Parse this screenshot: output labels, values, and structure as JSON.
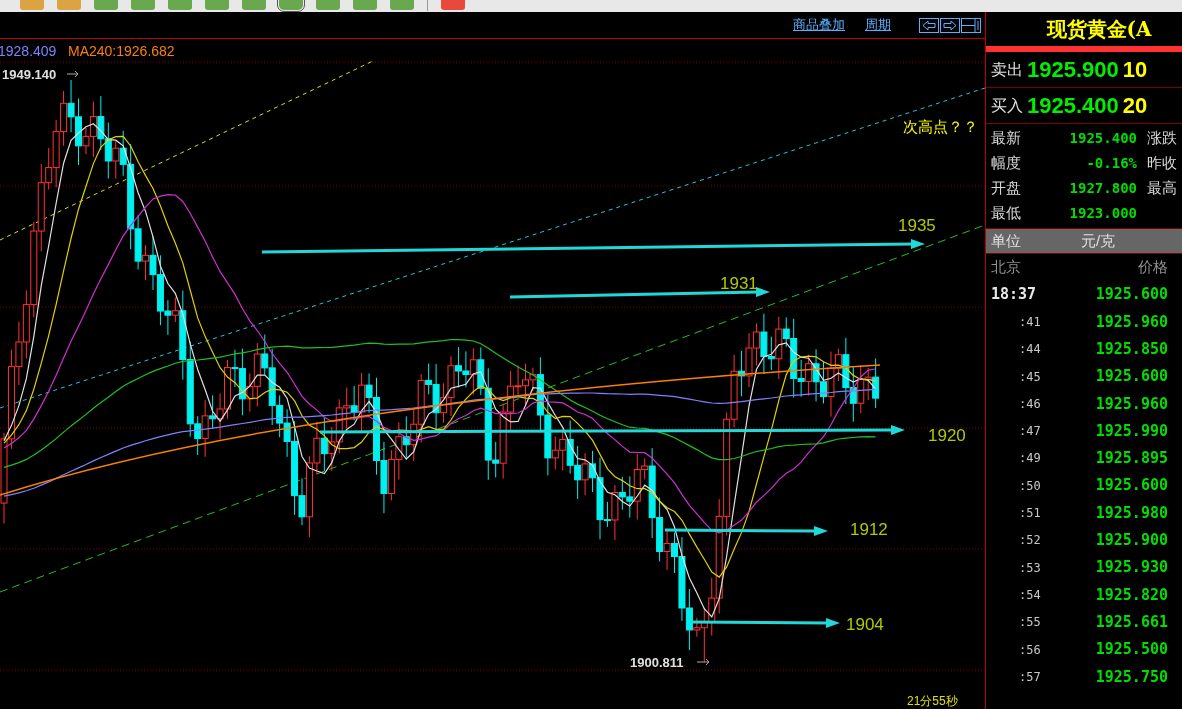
{
  "toolbar": {
    "buttons": [
      {
        "kind": "orange",
        "selected": false
      },
      {
        "kind": "orange",
        "selected": false
      },
      {
        "kind": "green",
        "selected": false
      },
      {
        "kind": "green",
        "selected": false
      },
      {
        "kind": "green",
        "selected": false
      },
      {
        "kind": "green",
        "selected": false
      },
      {
        "kind": "green",
        "selected": false
      },
      {
        "kind": "green",
        "selected": true
      },
      {
        "kind": "green",
        "selected": false
      },
      {
        "kind": "green",
        "selected": false
      },
      {
        "kind": "green",
        "selected": false
      },
      {
        "kind": "red",
        "selected": false
      }
    ]
  },
  "chart": {
    "links": [
      "商品叠加",
      "周期"
    ],
    "legend": [
      {
        "text": "1928.409",
        "color": "#8080ff"
      },
      {
        "text": "MA240:1926.682",
        "color": "#ff8000"
      }
    ],
    "high_label": "1949.140",
    "low_label": "1900.811",
    "note": "次高点？？",
    "levels": [
      {
        "label": "1935"
      },
      {
        "label": "1931"
      },
      {
        "label": "1920"
      },
      {
        "label": "1912"
      },
      {
        "label": "1904"
      }
    ],
    "countdown": "21分55秒"
  },
  "quote": {
    "title": "现货黄金(A",
    "sell": {
      "label": "卖出",
      "price": "1925.900",
      "volume": "10"
    },
    "buy": {
      "label": "买入",
      "price": "1925.400",
      "volume": "20"
    },
    "stats": [
      {
        "label": "最新",
        "value": "1925.400",
        "label_2": "涨跌"
      },
      {
        "label": "幅度",
        "value": "-0.16%",
        "label_2": "昨收"
      },
      {
        "label": "开盘",
        "value": "1927.800",
        "label_2": "最高"
      },
      {
        "label": "最低",
        "value": "1923.000"
      }
    ],
    "unit": {
      "label": "单位",
      "value": "元/克"
    },
    "ticks_header": {
      "time": "北京",
      "price": "价格"
    },
    "ticks": [
      {
        "time": "18:37",
        "price": "1925.600"
      },
      {
        "time": ":41",
        "price": "1925.960"
      },
      {
        "time": ":44",
        "price": "1925.850"
      },
      {
        "time": ":45",
        "price": "1925.600"
      },
      {
        "time": ":46",
        "price": "1925.960"
      },
      {
        "time": ":47",
        "price": "1925.990"
      },
      {
        "time": ":49",
        "price": "1925.895"
      },
      {
        "time": ":50",
        "price": "1925.600"
      },
      {
        "time": ":51",
        "price": "1925.980"
      },
      {
        "time": ":52",
        "price": "1925.900"
      },
      {
        "time": ":53",
        "price": "1925.930"
      },
      {
        "time": ":54",
        "price": "1925.820"
      },
      {
        "time": ":55",
        "price": "1925.661"
      },
      {
        "time": ":56",
        "price": "1925.500"
      },
      {
        "time": ":57",
        "price": "1925.750"
      }
    ]
  }
}
